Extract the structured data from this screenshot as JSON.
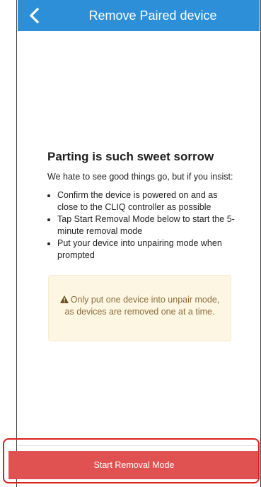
{
  "header": {
    "title": "Remove Paired device",
    "back_icon": "chevron-left-icon",
    "background_color": "#2e8fd9"
  },
  "content": {
    "heading": "Parting is such sweet sorrow",
    "intro": "We hate to see good things go, but if you insist:",
    "steps": [
      "Confirm the device is powered on and as close to the CLIQ controller as possible",
      "Tap Start Removal Mode below to start the 5-minute removal mode",
      "Put your device into unpairing mode when prompted"
    ]
  },
  "alert": {
    "icon": "warning-icon",
    "text": "Only put one device into unpair mode, as devices are removed one at a time.",
    "background_color": "#fdf6e3",
    "text_color": "#8a6d3b"
  },
  "footer": {
    "button_label": "Start Removal Mode",
    "button_color": "#e05252",
    "highlight_color": "#d9201b"
  }
}
